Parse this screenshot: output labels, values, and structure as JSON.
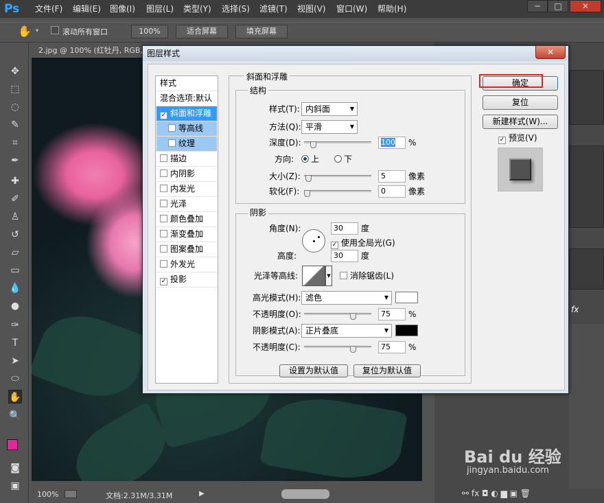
{
  "app": {
    "logo": "Ps"
  },
  "menu": [
    "文件(F)",
    "编辑(E)",
    "图像(I)",
    "图层(L)",
    "类型(Y)",
    "选择(S)",
    "滤镜(T)",
    "视图(V)",
    "窗口(W)",
    "帮助(H)"
  ],
  "window_controls": {
    "minimize": "─",
    "restore": "□",
    "close": "✕"
  },
  "options": {
    "scroll_all": "滚动所有窗口",
    "zoom": "100%",
    "fit_screen": "适合屏幕",
    "fill_screen": "填充屏幕"
  },
  "document": {
    "tab": "2.jpg @ 100% (红牡丹, RGB,"
  },
  "status": {
    "zoom": "100%",
    "doc_size": "文档:2.31M/3.31M"
  },
  "dialog": {
    "title": "图层样式",
    "close": "✕",
    "styles_header": "样式",
    "blend_options": "混合选项:默认",
    "styles": [
      {
        "label": "斜面和浮雕",
        "checked": "✓"
      },
      {
        "label": "等高线",
        "checked": ""
      },
      {
        "label": "纹理",
        "checked": ""
      },
      {
        "label": "描边",
        "checked": ""
      },
      {
        "label": "内阴影",
        "checked": ""
      },
      {
        "label": "内发光",
        "checked": ""
      },
      {
        "label": "光泽",
        "checked": ""
      },
      {
        "label": "颜色叠加",
        "checked": ""
      },
      {
        "label": "渐变叠加",
        "checked": ""
      },
      {
        "label": "图案叠加",
        "checked": ""
      },
      {
        "label": "外发光",
        "checked": ""
      },
      {
        "label": "投影",
        "checked": "✓"
      }
    ],
    "section_title": "斜面和浮雕",
    "structure": {
      "title": "结构",
      "style_label": "样式(T):",
      "style_value": "内斜面",
      "technique_label": "方法(Q):",
      "technique_value": "平滑",
      "depth_label": "深度(D):",
      "depth_value": "100",
      "depth_unit": "%",
      "depth_pct": 10,
      "direction_label": "方向:",
      "dir_up": "上",
      "dir_down": "下",
      "size_label": "大小(Z):",
      "size_value": "5",
      "size_unit": "像素",
      "size_pct": 2,
      "soften_label": "软化(F):",
      "soften_value": "0",
      "soften_unit": "像素",
      "soften_pct": 0
    },
    "shading": {
      "title": "阴影",
      "angle_label": "角度(N):",
      "angle_value": "30",
      "angle_unit": "度",
      "global_light": "使用全局光(G)",
      "altitude_label": "高度:",
      "altitude_value": "30",
      "altitude_unit": "度",
      "gloss_label": "光泽等高线:",
      "antialias": "消除锯齿(L)",
      "highlight_mode_label": "高光模式(H):",
      "highlight_mode": "滤色",
      "highlight_color": "#ffffff",
      "highlight_opacity_label": "不透明度(O):",
      "highlight_opacity": "75",
      "highlight_opacity_unit": "%",
      "highlight_pct": 75,
      "shadow_mode_label": "阴影模式(A):",
      "shadow_mode": "正片叠底",
      "shadow_color": "#000000",
      "shadow_opacity_label": "不透明度(C):",
      "shadow_opacity": "75",
      "shadow_opacity_unit": "%",
      "shadow_pct": 75
    },
    "make_default": "设置为默认值",
    "reset_default": "复位为默认值",
    "ok": "确定",
    "reset": "复位",
    "new_style": "新建样式(W)...",
    "preview": "预览(V)"
  },
  "colors": {
    "accent": "#31a8ff",
    "fg_swatch": "#e6269a",
    "bg_swatch": "#ffffff",
    "highlight_box": "#e02424"
  },
  "watermark": {
    "brand": "Bai du 经验",
    "url": "jingyan.baidu.com"
  }
}
